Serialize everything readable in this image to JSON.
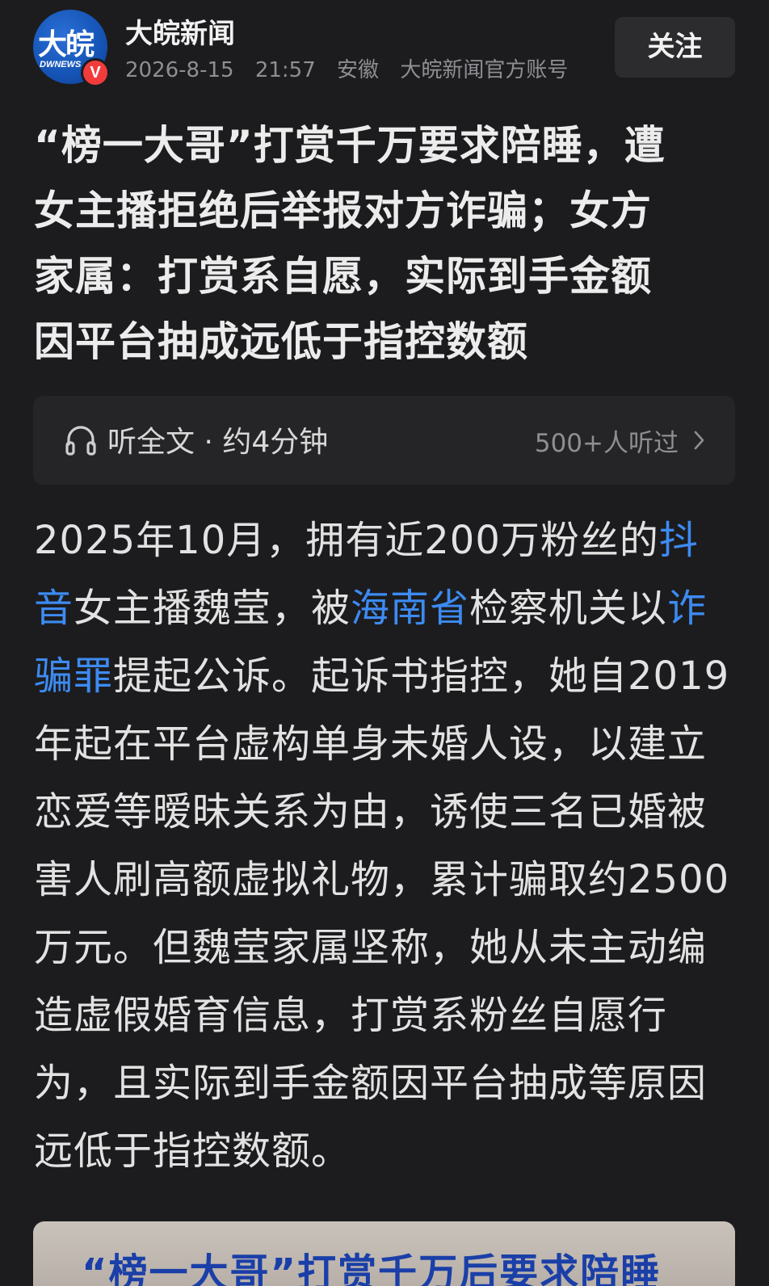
{
  "header": {
    "avatar_text": "大皖",
    "avatar_sub": "DWNEWS",
    "verified_badge": "V",
    "account_name": "大皖新闻",
    "date": "2026-8-15",
    "time": "21:57",
    "location": "安徽",
    "account_desc": "大皖新闻官方账号",
    "follow_label": "关注"
  },
  "article": {
    "title": "“榜一大哥”打赏千万要求陪睡，遭\n女主播拒绝后举报对方诈骗；女方\n家属：打赏系自愿，实际到手金额\n因平台抽成远低于指控数额"
  },
  "audio": {
    "label": "听全文 · 约4分钟",
    "listeners": "500+人听过"
  },
  "body": {
    "p1_a": "2025年10月，拥有近200万粉丝的",
    "link_douyin": "抖音",
    "p1_b": "女主播魏莹，被",
    "link_hainan": "海南省",
    "p1_c": "检察机关以",
    "link_fraud": "诈骗罪",
    "p1_d": "提起公诉。起诉书指控，她自2019年起在平台虚构单身未婚人设，以建立恋爱等暧昧关系为由，诱使三名已婚被害人刷高额虚拟礼物，累计骗取约2500万元。但魏莹家属坚称，她从未主动编造虚假婚育信息，打赏系粉丝自愿行为，且实际到手金额因平台抽成等原因远低于指控数额。"
  },
  "image_preview": {
    "caption": "“榜一大哥”打赏千万后要求陪睡"
  },
  "colors": {
    "background": "#1c1c1e",
    "link": "#3d8bf2",
    "muted": "#8e8e93",
    "badge": "#f23b3b"
  }
}
